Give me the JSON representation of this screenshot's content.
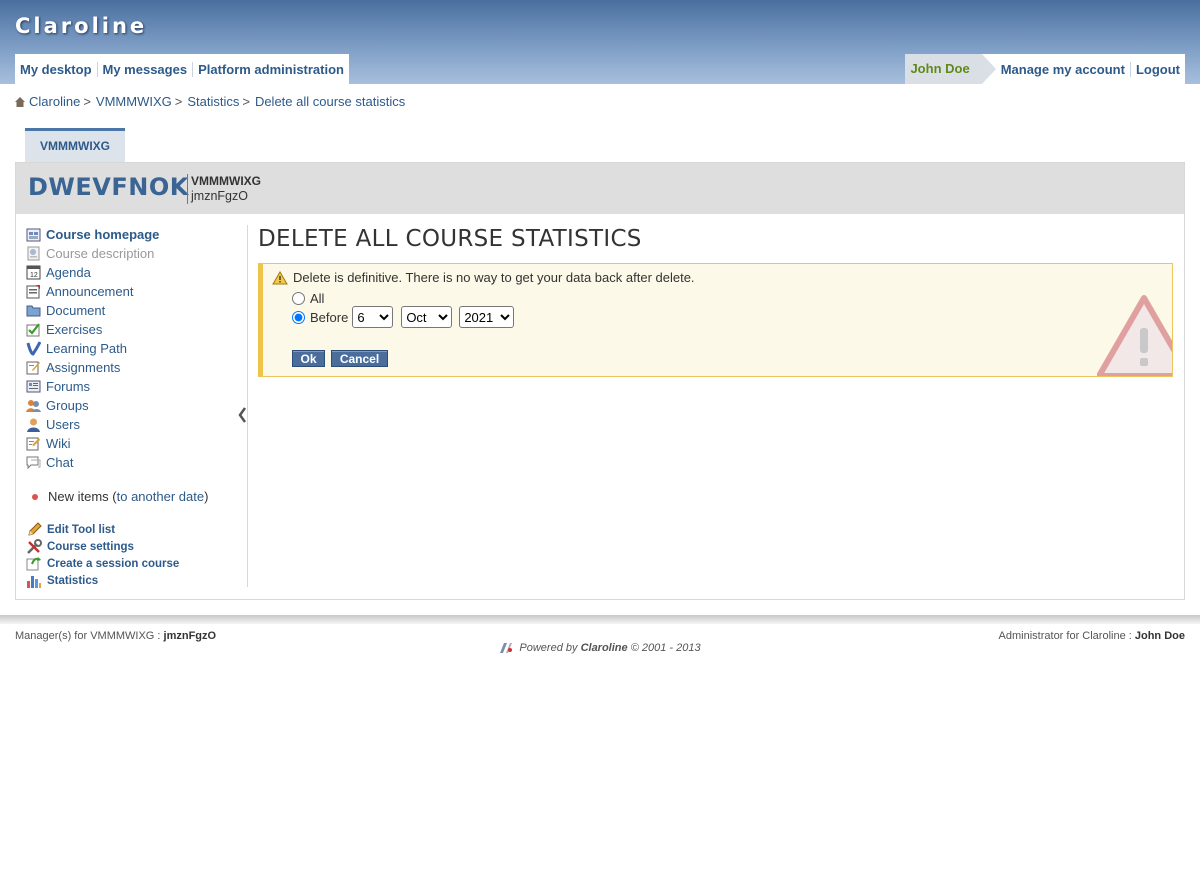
{
  "app": {
    "logo": "Claroline"
  },
  "nav": {
    "left": [
      "My desktop",
      "My messages",
      "Platform administration"
    ],
    "user": "John Doe",
    "right": [
      "Manage my account",
      "Logout"
    ]
  },
  "breadcrumb": [
    "Claroline",
    "VMMMWIXG",
    "Statistics",
    "Delete all course statistics"
  ],
  "breadcrumb_sep": ">",
  "course": {
    "tab": "VMMMWIXG",
    "code": "DWEVFNOK",
    "title": "VMMMWIXG",
    "manager": "jmznFgzO"
  },
  "tools": [
    {
      "label": "Course homepage",
      "icon": "home-icon"
    },
    {
      "label": "Course description",
      "icon": "description-icon",
      "disabled": true
    },
    {
      "label": "Agenda",
      "icon": "calendar-icon"
    },
    {
      "label": "Announcement",
      "icon": "announcement-icon"
    },
    {
      "label": "Document",
      "icon": "folder-icon"
    },
    {
      "label": "Exercises",
      "icon": "exercise-icon"
    },
    {
      "label": "Learning Path",
      "icon": "learning-path-icon"
    },
    {
      "label": "Assignments",
      "icon": "assignment-icon"
    },
    {
      "label": "Forums",
      "icon": "forum-icon"
    },
    {
      "label": "Groups",
      "icon": "group-icon"
    },
    {
      "label": "Users",
      "icon": "user-icon"
    },
    {
      "label": "Wiki",
      "icon": "wiki-icon"
    },
    {
      "label": "Chat",
      "icon": "chat-icon"
    }
  ],
  "new_items": {
    "label": "New items (",
    "link": "to another date",
    "close": ")"
  },
  "manage": [
    {
      "label": "Edit Tool list",
      "icon": "pencil-icon"
    },
    {
      "label": "Course settings",
      "icon": "tools-icon"
    },
    {
      "label": "Create a session course",
      "icon": "session-icon"
    },
    {
      "label": "Statistics",
      "icon": "statistics-icon"
    }
  ],
  "content": {
    "title": "DELETE ALL COURSE STATISTICS",
    "warning": "Delete is definitive. There is no way to get your data back after delete.",
    "option_all": "All",
    "option_before": "Before",
    "day": "6",
    "month": "Oct",
    "year": "2021",
    "ok": "Ok",
    "cancel": "Cancel"
  },
  "footer": {
    "manager_label": "Manager(s) for VMMMWIXG : ",
    "manager": "jmznFgzO",
    "admin_label": "Administrator for Claroline : ",
    "admin": "John Doe",
    "powered_prefix": "Powered by ",
    "powered_name": "Claroline",
    "powered_suffix": " © 2001 - 2013"
  },
  "colors": {
    "header_top": "#4a6f9f",
    "link": "#2c5a8a",
    "user": "#5f8a1a",
    "warning_bg": "#fcf9e8"
  }
}
